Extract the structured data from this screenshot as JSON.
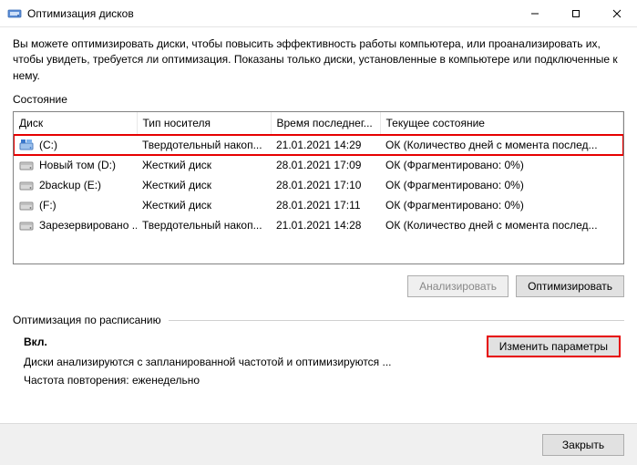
{
  "window": {
    "title": "Оптимизация дисков"
  },
  "intro": "Вы можете оптимизировать диски, чтобы повысить эффективность работы  компьютера, или проанализировать их, чтобы увидеть, требуется ли оптимизация. Показаны только диски, установленные в компьютере или подключенные к нему.",
  "state_label": "Состояние",
  "columns": {
    "disk": "Диск",
    "type": "Тип носителя",
    "time": "Время последнег...",
    "status": "Текущее состояние"
  },
  "rows": [
    {
      "name": "(C:)",
      "icon": "c",
      "type": "Твердотельный накоп...",
      "time": "21.01.2021 14:29",
      "status": "ОК (Количество дней с момента послед...",
      "highlighted": true
    },
    {
      "name": "Новый том (D:)",
      "icon": "hdd",
      "type": "Жесткий диск",
      "time": "28.01.2021 17:09",
      "status": "ОК (Фрагментировано: 0%)",
      "highlighted": false
    },
    {
      "name": "2backup (E:)",
      "icon": "hdd",
      "type": "Жесткий диск",
      "time": "28.01.2021 17:10",
      "status": "ОК (Фрагментировано: 0%)",
      "highlighted": false
    },
    {
      "name": "(F:)",
      "icon": "hdd",
      "type": "Жесткий диск",
      "time": "28.01.2021 17:11",
      "status": "ОК (Фрагментировано: 0%)",
      "highlighted": false
    },
    {
      "name": "Зарезервировано ...",
      "icon": "hdd",
      "type": "Твердотельный накоп...",
      "time": "21.01.2021 14:28",
      "status": "ОК (Количество дней с момента послед...",
      "highlighted": false
    }
  ],
  "buttons": {
    "analyze": "Анализировать",
    "optimize": "Оптимизировать",
    "change_params": "Изменить параметры",
    "close": "Закрыть"
  },
  "schedule": {
    "header": "Оптимизация по расписанию",
    "status": "Вкл.",
    "line1": "Диски анализируются с запланированной частотой и оптимизируются ...",
    "line2": "Частота повторения: еженедельно"
  }
}
